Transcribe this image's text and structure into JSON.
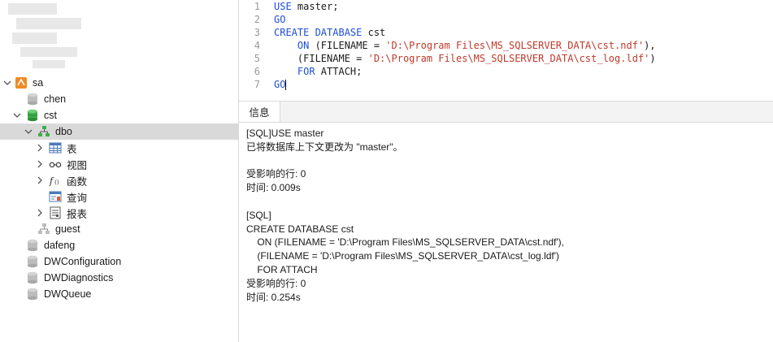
{
  "sidebar": {
    "items": [
      {
        "label": "sa",
        "icon": "server-icon",
        "expanded": true
      },
      {
        "label": "chen",
        "icon": "database-icon"
      },
      {
        "label": "cst",
        "icon": "database-open-icon",
        "expanded": true
      },
      {
        "label": "dbo",
        "icon": "schema-icon",
        "expanded": true,
        "selected": true
      },
      {
        "label": "表",
        "icon": "table-icon"
      },
      {
        "label": "视图",
        "icon": "view-icon"
      },
      {
        "label": "函数",
        "icon": "function-icon"
      },
      {
        "label": "查询",
        "icon": "query-icon"
      },
      {
        "label": "报表",
        "icon": "report-icon"
      },
      {
        "label": "guest",
        "icon": "schema-icon"
      },
      {
        "label": "dafeng",
        "icon": "database-icon"
      },
      {
        "label": "DWConfiguration",
        "icon": "database-icon"
      },
      {
        "label": "DWDiagnostics",
        "icon": "database-icon"
      },
      {
        "label": "DWQueue",
        "icon": "database-icon"
      }
    ]
  },
  "editor": {
    "lines": [
      {
        "num": "1",
        "parts": [
          {
            "t": "USE",
            "c": "kw"
          },
          {
            "t": " master;",
            "c": "plain"
          }
        ]
      },
      {
        "num": "2",
        "parts": [
          {
            "t": "GO",
            "c": "kw"
          }
        ]
      },
      {
        "num": "3",
        "parts": [
          {
            "t": "CREATE DATABASE",
            "c": "kw"
          },
          {
            "t": " cst",
            "c": "plain"
          }
        ]
      },
      {
        "num": "4",
        "parts": [
          {
            "t": "    ON",
            "c": "kw"
          },
          {
            "t": " (FILENAME = ",
            "c": "plain"
          },
          {
            "t": "'D:\\Program Files\\MS_SQLSERVER_DATA\\cst.ndf'",
            "c": "str"
          },
          {
            "t": "),",
            "c": "plain"
          }
        ]
      },
      {
        "num": "5",
        "parts": [
          {
            "t": "    (FILENAME = ",
            "c": "plain"
          },
          {
            "t": "'D:\\Program Files\\MS_SQLSERVER_DATA\\cst_log.ldf'",
            "c": "str"
          },
          {
            "t": ")",
            "c": "plain"
          }
        ]
      },
      {
        "num": "6",
        "parts": [
          {
            "t": "    FOR",
            "c": "kw"
          },
          {
            "t": " ATTACH;",
            "c": "plain"
          }
        ]
      },
      {
        "num": "7",
        "parts": [
          {
            "t": "GO",
            "c": "kw"
          }
        ],
        "cursor": true
      }
    ]
  },
  "tabs": {
    "info": "信息"
  },
  "output": {
    "lines": [
      "[SQL]USE master",
      "已将数据库上下文更改为 \"master\"。",
      "",
      "受影响的行: 0",
      "时间: 0.009s",
      "",
      "[SQL]",
      "CREATE DATABASE cst",
      "    ON (FILENAME = 'D:\\Program Files\\MS_SQLSERVER_DATA\\cst.ndf'),",
      "    (FILENAME = 'D:\\Program Files\\MS_SQLSERVER_DATA\\cst_log.ldf')",
      "    FOR ATTACH",
      "受影响的行: 0",
      "时间: 0.254s"
    ]
  },
  "colors": {
    "keyword": "#1f4fd6",
    "string": "#c0392b",
    "selected_row": "#d9d9d9"
  }
}
